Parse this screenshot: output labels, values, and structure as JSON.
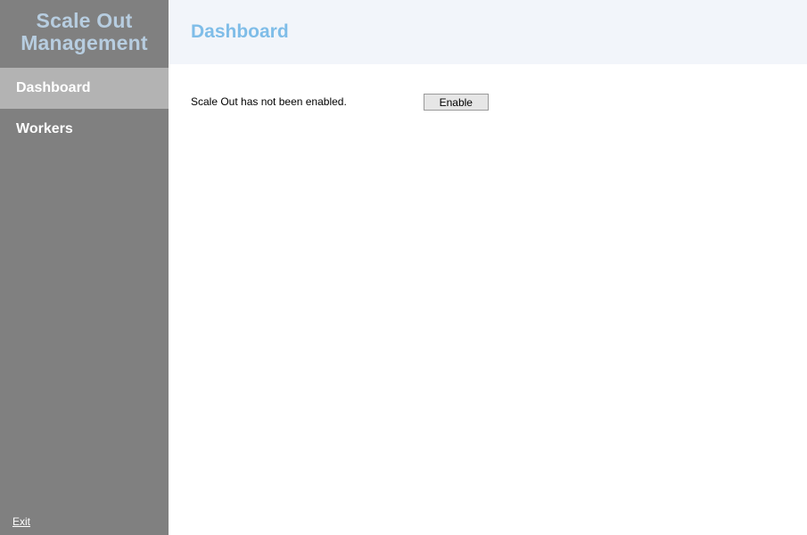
{
  "brand": {
    "line1": "Scale Out",
    "line2": "Management"
  },
  "sidebar": {
    "items": [
      {
        "label": "Dashboard",
        "active": true
      },
      {
        "label": "Workers",
        "active": false
      }
    ],
    "exit_label": "Exit"
  },
  "header": {
    "title": "Dashboard"
  },
  "content": {
    "status_text": "Scale Out has not been enabled.",
    "enable_button_label": "Enable"
  }
}
